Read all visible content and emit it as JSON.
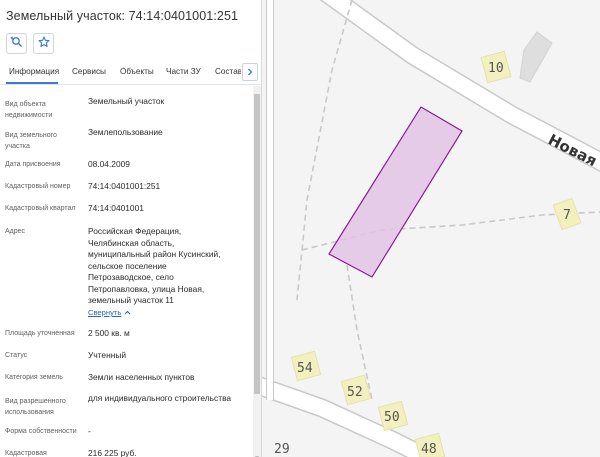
{
  "panel": {
    "title": "Земельный участок: 74:14:0401001:251"
  },
  "tabs": [
    {
      "label": "Информация",
      "active": true
    },
    {
      "label": "Сервисы"
    },
    {
      "label": "Объекты"
    },
    {
      "label": "Части ЗУ"
    },
    {
      "label": "Состав"
    }
  ],
  "info": {
    "object_type": {
      "label": "Вид объекта недвижимости",
      "value": "Земельный участок"
    },
    "land_type": {
      "label": "Вид земельного участка",
      "value": "Землепользование"
    },
    "assigned_date": {
      "label": "Дата присвоения",
      "value": "08.04.2009"
    },
    "cad_number": {
      "label": "Кадастровый номер",
      "value": "74:14:0401001:251"
    },
    "cad_block": {
      "label": "Кадастровый квартал",
      "value": "74:14:0401001"
    },
    "address": {
      "label": "Адрес",
      "lines": [
        "Российская Федерация,",
        "Челябинская область,",
        "муниципальный район Кусинский,",
        "сельское поселение",
        "Петрозаводское, село",
        "Петропавловка, улица Новая,",
        "земельный участок 11"
      ]
    },
    "collapse_label": "Свернуть",
    "area": {
      "label": "Площадь уточненная",
      "value": "2 500 кв. м"
    },
    "status": {
      "label": "Статус",
      "value": "Учтенный"
    },
    "category": {
      "label": "Категория земель",
      "value": "Земли населенных пунктов"
    },
    "permitted_use": {
      "label": "Вид разрешенного использования",
      "value": "для индивидуального строительства"
    },
    "ownership": {
      "label": "Форма собственности",
      "value": "-"
    },
    "cad_value": {
      "label": "Кадастровая",
      "value": "216 225 руб."
    }
  },
  "map": {
    "street_label": "Новая",
    "house_numbers": [
      "10",
      "7",
      "54",
      "52",
      "50",
      "48",
      "29"
    ],
    "parcel_fill": "#e3c3e6",
    "parcel_stroke": "#8a1f8f"
  },
  "colors": {
    "accent": "#3a7bd5",
    "link": "#2a62c9"
  }
}
